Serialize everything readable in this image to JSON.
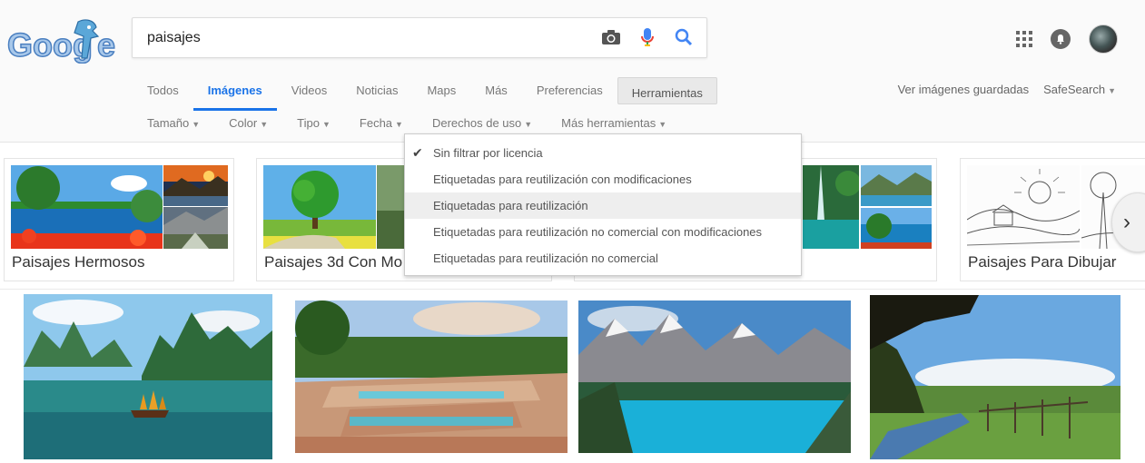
{
  "search": {
    "query": "paisajes"
  },
  "tabs": [
    {
      "label": "Todos"
    },
    {
      "label": "Imágenes"
    },
    {
      "label": "Videos"
    },
    {
      "label": "Noticias"
    },
    {
      "label": "Maps"
    },
    {
      "label": "Más"
    },
    {
      "label": "Preferencias"
    },
    {
      "label": "Herramientas"
    }
  ],
  "tools_right": {
    "saved": "Ver imágenes guardadas",
    "safesearch": "SafeSearch"
  },
  "subtools": [
    {
      "label": "Tamaño"
    },
    {
      "label": "Color"
    },
    {
      "label": "Tipo"
    },
    {
      "label": "Fecha"
    },
    {
      "label": "Derechos de uso"
    },
    {
      "label": "Más herramientas"
    }
  ],
  "dropdown": {
    "items": [
      {
        "label": "Sin filtrar por licencia",
        "checked": true
      },
      {
        "label": "Etiquetadas para reutilización con modificaciones"
      },
      {
        "label": "Etiquetadas para reutilización",
        "hover": true
      },
      {
        "label": "Etiquetadas para reutilización no comercial con modificaciones"
      },
      {
        "label": "Etiquetadas para reutilización no comercial"
      }
    ]
  },
  "cards": [
    {
      "label": "Paisajes Hermosos"
    },
    {
      "label": "Paisajes 3d Con Mo"
    },
    {
      "label": ""
    },
    {
      "label": "Paisajes Para Dibujar"
    }
  ],
  "icons": {
    "camera": "camera-icon",
    "mic": "mic-icon",
    "search": "search-icon",
    "apps": "apps-grid-icon",
    "notifications": "bell-icon",
    "next": "chevron-right-icon"
  },
  "colors": {
    "accent": "#1a73e8",
    "mic_red": "#ea4335",
    "search_blue": "#4285f4"
  }
}
